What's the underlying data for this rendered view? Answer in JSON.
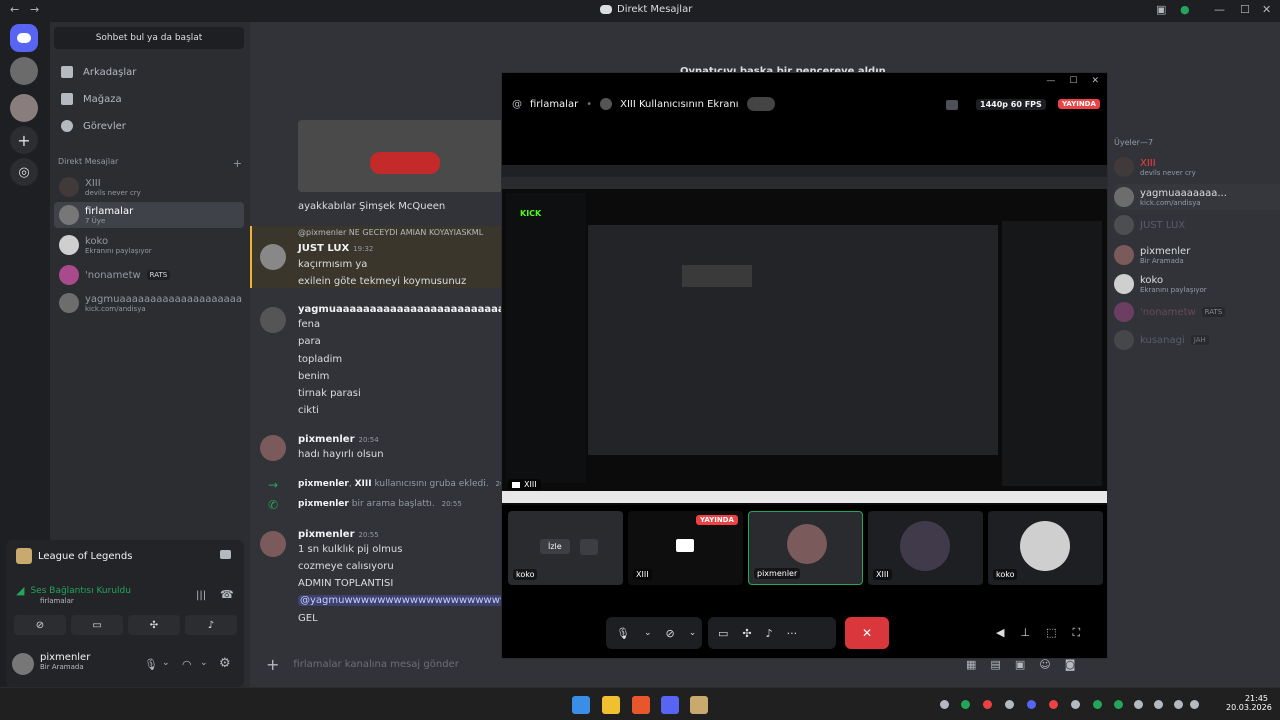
{
  "window": {
    "title": "Direkt Mesajlar"
  },
  "dmlist": {
    "search_label": "Sohbet bul ya da başlat",
    "nav": [
      "Arkadaşlar",
      "Mağaza",
      "Görevler"
    ],
    "section_header": "Direkt Mesajlar",
    "add_label": "+",
    "items": [
      {
        "name": "XIII",
        "sub": "devils never cry"
      },
      {
        "name": "firlamalar",
        "sub": "7 Üye"
      },
      {
        "name": "koko",
        "sub": "Ekranını paylaşıyor"
      },
      {
        "name": "'nonametw",
        "sub": "",
        "tag": "RATS"
      },
      {
        "name": "yagmuaaaaaaaaaaaaaaaaaaaa",
        "sub": "kick.com/andisya"
      }
    ]
  },
  "voice": {
    "activity": "League of Legends",
    "status": "Ses Bağlantısı Kuruldu",
    "channel": "firlamalar"
  },
  "user": {
    "name": "pixmenler",
    "status": "Bir Aramada"
  },
  "chat": {
    "popout_notice": "Oynatıcıyı başka bir pencereye aldın",
    "caption": "ayakkabılar Şimşek McQueen",
    "reply_ref": "@pixmenler NE GECEYDI AMIAN KOYAYIASKML",
    "messages": [
      {
        "user": "JUST LUX",
        "time": "19:32",
        "lines": [
          "kaçırmısım ya",
          "exilein göte tekmeyi koymusunuz"
        ]
      },
      {
        "user": "yagmuaaaaaaaaaaaaaaaaaaaaaaaaaaaa",
        "time": "",
        "lines": [
          "fena",
          "para",
          "topladim",
          "benim",
          "tirnak parasi",
          "cikti"
        ]
      },
      {
        "user": "pixmenler",
        "time": "20:54",
        "lines": [
          "hadı hayırlı olsun"
        ]
      },
      {
        "user": "pixmenler",
        "time": "20:55",
        "lines": [
          "1 sn kulklık pij olmus",
          "cozmeye calısıyoru",
          "ADMIN TOPLANTISI",
          "@yagmuwwwwwwwwwwwwwwwwwwwwwwwww",
          "GEL"
        ]
      }
    ],
    "system1": {
      "user1": "pixmenler",
      "user2": "XIII",
      "text": "kullanıcısını gruba ekledi.",
      "time": "20:5"
    },
    "system2": {
      "user": "pixmenler",
      "text": "bir arama başlattı.",
      "time": "20:55"
    },
    "composer_placeholder": "firlamalar kanalına mesaj gönder"
  },
  "popout": {
    "channel": "firlamalar",
    "stream_title": "XIII Kullanıcısının Ekranı",
    "quality": "1440p 60 FPS",
    "live": "YAYINDA",
    "tiles": [
      {
        "label": "koko",
        "watch": "İzle"
      },
      {
        "label": "XIII",
        "badge": "YAYINDA"
      },
      {
        "label": "pixmenler"
      },
      {
        "label": "XIII"
      },
      {
        "label": "koko"
      }
    ],
    "stream_label": "XIII"
  },
  "members": {
    "header": "Üyeler—7",
    "list": [
      {
        "name": "XIII",
        "sub": "devils never cry",
        "color": "#f23f43"
      },
      {
        "name": "yagmuaaaaaaa...",
        "sub": "kick.com/andisya",
        "color": "#dbdee1"
      },
      {
        "name": "JUST LUX",
        "sub": "",
        "color": "#5c5e66"
      },
      {
        "name": "pixmenler",
        "sub": "Bir Aramada",
        "color": "#dbdee1"
      },
      {
        "name": "koko",
        "sub": "Ekranını paylaşıyor",
        "color": "#dbdee1"
      },
      {
        "name": "'nonametw",
        "sub": "",
        "tag": "RATS",
        "color": "#a25d7c"
      },
      {
        "name": "kusanagi",
        "sub": "",
        "tag": "JAH",
        "color": "#5c5e66"
      }
    ]
  },
  "taskbar": {
    "time": "21:45",
    "date": "20.03.2026"
  },
  "colors": {
    "accent": "#5865f2",
    "live": "#ed4245",
    "online": "#23a55a",
    "end_call": "#da373c"
  }
}
